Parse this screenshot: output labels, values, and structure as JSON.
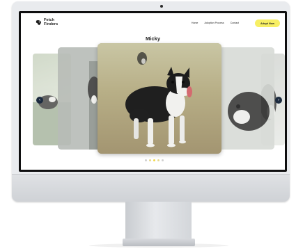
{
  "brand": {
    "name_line1": "Fetch",
    "name_line2": "Finders",
    "logo_icon": "dog-head-icon"
  },
  "nav": {
    "items": [
      "Home",
      "Adoption Process",
      "Contact"
    ],
    "cta_label": "Adopt Now",
    "cta_color": "#f7ef64"
  },
  "carousel": {
    "current_title": "Micky",
    "slide_count": 5,
    "active_index": 2,
    "prev_icon": "chevron-left-icon",
    "next_icon": "chevron-right-icon",
    "arrow_color": "#1c2b3f",
    "active_dot_color": "#f2d84a"
  }
}
